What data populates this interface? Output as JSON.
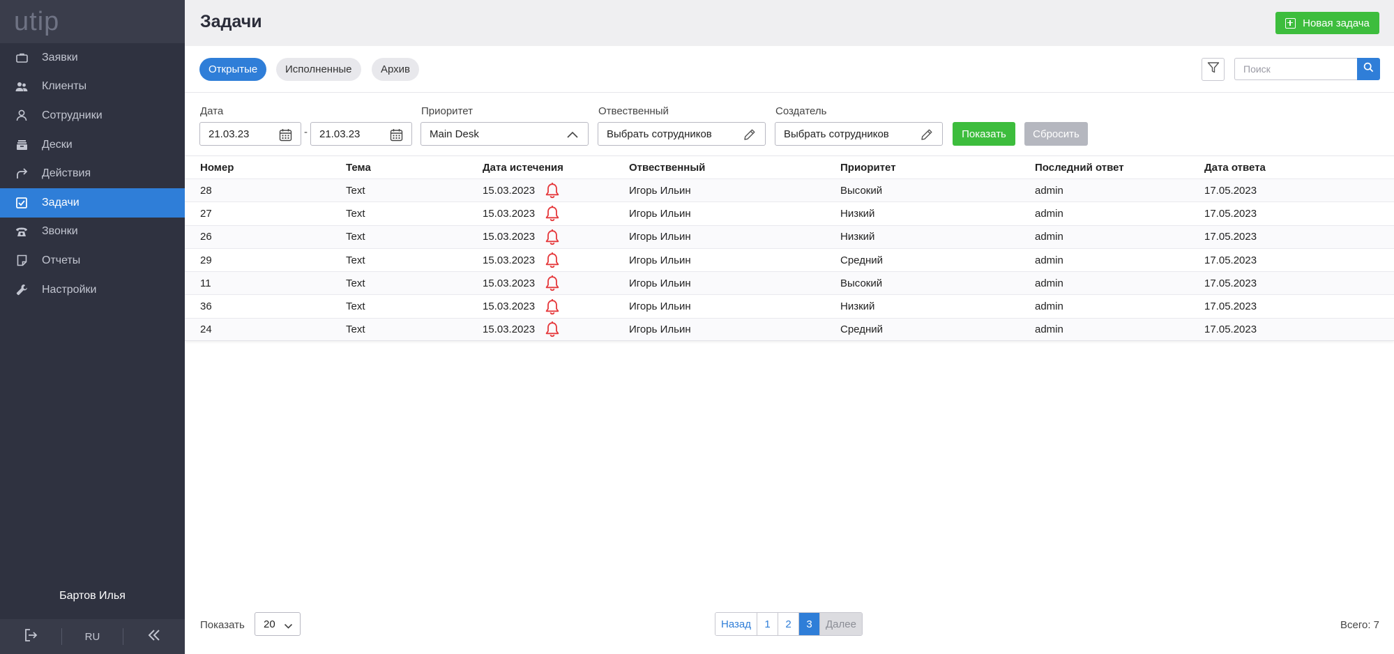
{
  "sidebar": {
    "logo": "utip",
    "items": [
      {
        "label": "Заявки",
        "icon": "briefcase-icon",
        "active": false
      },
      {
        "label": "Клиенты",
        "icon": "clients-icon",
        "active": false
      },
      {
        "label": "Сотрудники",
        "icon": "user-icon",
        "active": false
      },
      {
        "label": "Дески",
        "icon": "desk-icon",
        "active": false
      },
      {
        "label": "Действия",
        "icon": "share-arrow-icon",
        "active": false
      },
      {
        "label": "Задачи",
        "icon": "checkbox-icon",
        "active": true
      },
      {
        "label": "Звонки",
        "icon": "phone-icon",
        "active": false
      },
      {
        "label": "Отчеты",
        "icon": "report-icon",
        "active": false
      },
      {
        "label": "Настройки",
        "icon": "wrench-icon",
        "active": false
      }
    ],
    "user_name": "Бартов Илья",
    "language": "RU"
  },
  "header": {
    "title": "Задачи",
    "new_task_label": "Новая задача"
  },
  "tabs": [
    {
      "label": "Открытые",
      "active": true
    },
    {
      "label": "Исполненные",
      "active": false
    },
    {
      "label": "Архив",
      "active": false
    }
  ],
  "search": {
    "placeholder": "Поиск"
  },
  "filters": {
    "date_label": "Дата",
    "date_from": "21.03.23",
    "date_to": "21.03.23",
    "date_separator": "-",
    "priority_label": "Приоритет",
    "priority_value": "Main Desk",
    "responsible_label": "Отвественный",
    "responsible_value": "Выбрать сотрудников",
    "creator_label": "Создатель",
    "creator_value": "Выбрать сотрудников",
    "show_label": "Показать",
    "reset_label": "Сбросить"
  },
  "table": {
    "columns": [
      "Номер",
      "Тема",
      "Дата истечения",
      "Отвественный",
      "Приоритет",
      "Последний ответ",
      "Дата ответа"
    ],
    "rows": [
      [
        "28",
        "Text",
        "15.03.2023",
        "Игорь Ильин",
        "Высокий",
        "admin",
        "17.05.2023"
      ],
      [
        "27",
        "Text",
        "15.03.2023",
        "Игорь Ильин",
        "Низкий",
        "admin",
        "17.05.2023"
      ],
      [
        "26",
        "Text",
        "15.03.2023",
        "Игорь Ильин",
        "Низкий",
        "admin",
        "17.05.2023"
      ],
      [
        "29",
        "Text",
        "15.03.2023",
        "Игорь Ильин",
        "Средний",
        "admin",
        "17.05.2023"
      ],
      [
        "11",
        "Text",
        "15.03.2023",
        "Игорь Ильин",
        "Высокий",
        "admin",
        "17.05.2023"
      ],
      [
        "36",
        "Text",
        "15.03.2023",
        "Игорь Ильин",
        "Низкий",
        "admin",
        "17.05.2023"
      ],
      [
        "24",
        "Text",
        "15.03.2023",
        "Игорь Ильин",
        "Средний",
        "admin",
        "17.05.2023"
      ]
    ]
  },
  "footer": {
    "show_label": "Показать",
    "per_page": "20",
    "pager": {
      "prev": "Назад",
      "pages": [
        "1",
        "2",
        "3"
      ],
      "current": "3",
      "next": "Далее"
    },
    "total": "Всего: 7"
  },
  "colors": {
    "sidebar_bg": "#2f3240",
    "accent_blue": "#2f7ed8",
    "green": "#3dbd3d",
    "bell_red": "#e5383b"
  }
}
